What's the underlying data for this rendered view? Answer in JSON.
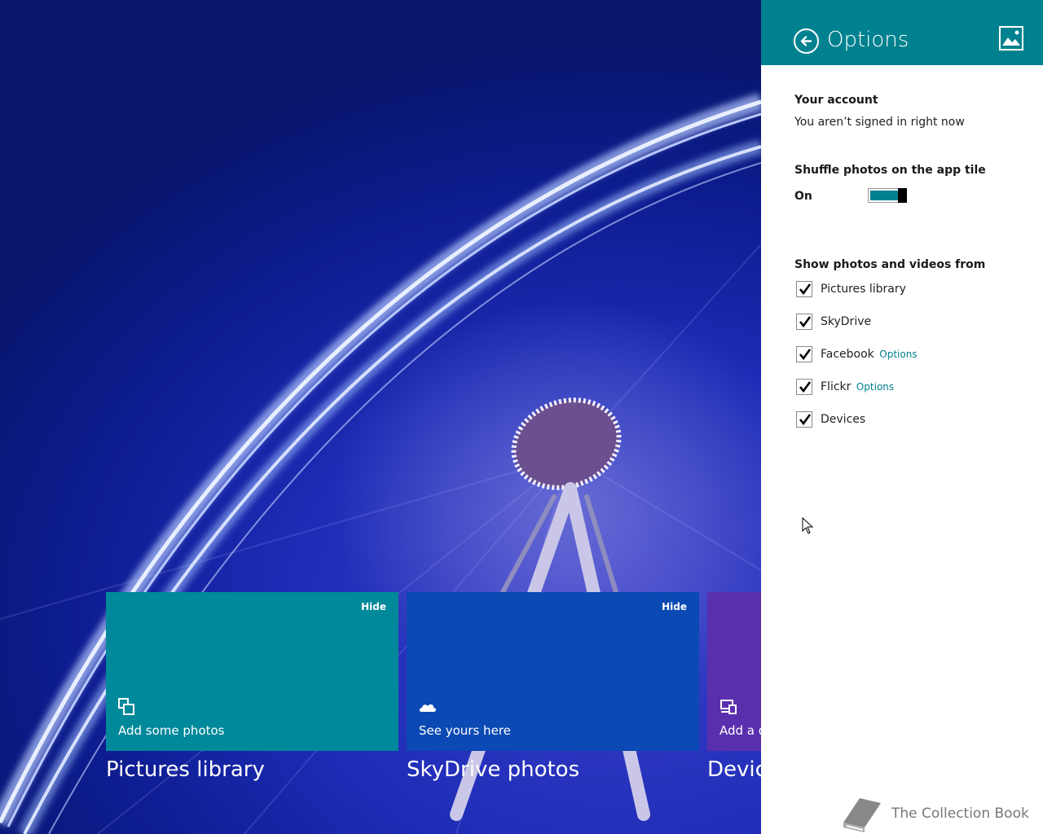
{
  "colors": {
    "accent": "#00818f",
    "tile_pictures": "#00889b",
    "tile_skydrive": "#0b49b4",
    "tile_devices": "#5a2fae"
  },
  "tiles": [
    {
      "hide": "Hide",
      "label": "Add some photos",
      "title": "Pictures library",
      "icon": "pictures-library-icon"
    },
    {
      "hide": "Hide",
      "label": "See yours here",
      "title": "SkyDrive photos",
      "icon": "skydrive-cloud-icon"
    },
    {
      "label": "Add a d",
      "title": "Devic",
      "icon": "devices-icon"
    }
  ],
  "pane": {
    "title": "Options",
    "account": {
      "heading": "Your account",
      "status": "You aren’t signed in right now"
    },
    "shuffle": {
      "heading": "Shuffle photos on the app tile",
      "state": "On",
      "on": true
    },
    "sources": {
      "heading": "Show photos and videos from",
      "items": [
        {
          "label": "Pictures library",
          "checked": true,
          "options": ""
        },
        {
          "label": "SkyDrive",
          "checked": true,
          "options": ""
        },
        {
          "label": "Facebook",
          "checked": true,
          "options": "Options"
        },
        {
          "label": "Flickr",
          "checked": true,
          "options": "Options"
        },
        {
          "label": "Devices",
          "checked": true,
          "options": ""
        }
      ]
    }
  },
  "watermark": "The Collection Book"
}
